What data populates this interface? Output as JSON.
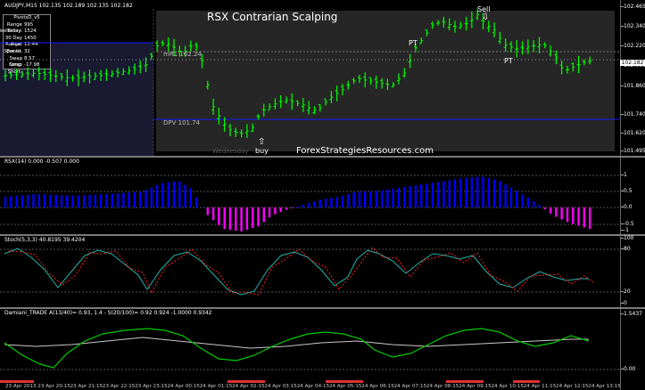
{
  "chart_header": {
    "symbol_line": "AUDJPY,M15  102.135 102.189 102.135 102.182"
  },
  "pivot_panel": {
    "title": "PivotsD_v5",
    "rows": [
      {
        "label": "Range Today:",
        "value": "995"
      },
      {
        "label": "Yesterday:",
        "value": "1524"
      },
      {
        "label": "30 Day Range:",
        "value": "1450"
      },
      {
        "label": "Next Bar In:",
        "value": "12:44"
      },
      {
        "label": "Spread:",
        "value": "32"
      },
      {
        "label": "Swap Long:",
        "value": "8.57"
      },
      {
        "label": "Swap Short:",
        "value": "-17.98"
      }
    ]
  },
  "main_chart": {
    "title": "RSX Contrarian Scalping",
    "site": "ForexStrategiesResources.com",
    "mr1_label": "mR1",
    "mr1_value": "102.24",
    "dpv_label": "DPV",
    "dpv_value": "101.74",
    "day_label": "Wednesday",
    "annotations": {
      "buy": "buy",
      "sell": "Sell",
      "pt1": "PT",
      "pt2": "PT"
    },
    "current_price": "102.182",
    "price_ticks": [
      "102.465",
      "102.340",
      "102.220",
      "102.095",
      "101.860",
      "101.740",
      "101.620",
      "101.495"
    ]
  },
  "rsx_panel": {
    "title": "RSX(14) 0.000 -0.507 0.000",
    "ticks": [
      "1",
      "0.5",
      "0.0",
      "-0.5",
      "-1"
    ]
  },
  "stoch_panel": {
    "title": "Stoch(5,3,3) 40.8195 39.4204",
    "ticks": [
      "100",
      "80",
      "20",
      "0"
    ]
  },
  "damiani_panel": {
    "title": "Damiani_TRADE  A(13/40)= 0.93, 1.4 - S(20/100)= 0.92  0.924 -1.0000 0.9342",
    "ticks": [
      "1.5437",
      "0.00"
    ]
  },
  "time_axis": [
    "23 Apr 2013",
    "23 Apr 20:15",
    "23 Apr 21:15",
    "23 Apr 22:15",
    "23 Apr 23:15",
    "24 Apr 00:15",
    "24 Apr 01:15",
    "24 Apr 02:15",
    "24 Apr 03:15",
    "24 Apr 04:15",
    "24 Apr 05:15",
    "24 Apr 06:15",
    "24 Apr 07:15",
    "24 Apr 08:15",
    "24 Apr 09:15",
    "24 Apr 10:15",
    "24 Apr 11:15",
    "24 Apr 12:15",
    "24 Apr 13:15"
  ],
  "colors": {
    "bull": "#00ff00",
    "rsx_pos": "#0000ff",
    "rsx_neg": "#ff00ff",
    "stoch_main": "#20b2aa",
    "stoch_signal": "#ff2020",
    "damiani_a": "#00cc00",
    "damiani_b": "#c8c8c8",
    "grid": "#555555"
  }
}
